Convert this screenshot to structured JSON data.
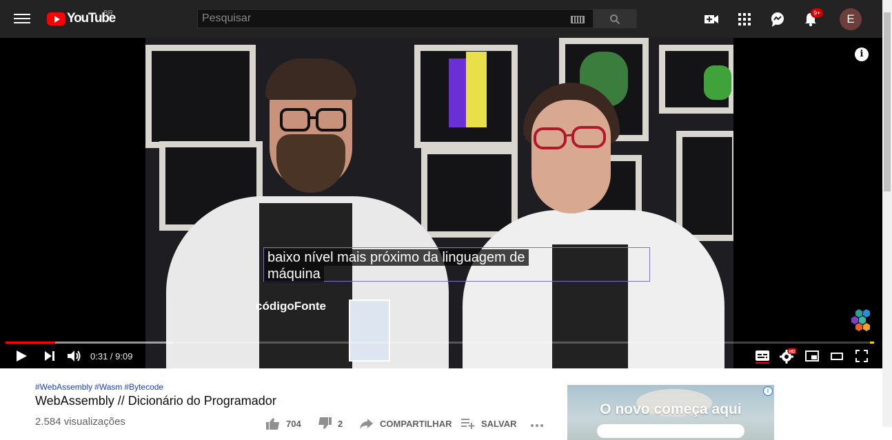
{
  "header": {
    "logo_text": "YouTube",
    "region": "BR",
    "search_placeholder": "Pesquisar",
    "notification_count": "9+",
    "avatar_letter": "E"
  },
  "player": {
    "caption_lines": [
      "baixo nível mais próximo da linguagem de",
      "máquina"
    ],
    "shirt_logo_text": "códigoFonte",
    "time_current": "0:31",
    "time_total": "9:09",
    "time_display": "0:31 / 9:09",
    "progress_played": 0.057,
    "progress_buffered": 0.193,
    "info_label": "i",
    "hd_badge": "HD"
  },
  "video": {
    "hashtags": [
      "#WebAssembly",
      "#Wasm",
      "#Bytecode"
    ],
    "title": "WebAssembly // Dicionário do Programador",
    "views": "2.584 visualizações",
    "likes": "704",
    "dislikes": "2",
    "share_label": "COMPARTILHAR",
    "save_label": "SALVAR"
  },
  "ad": {
    "text": "O novo começa aqui",
    "choice_label": "i"
  },
  "colors": {
    "masthead": "#232323",
    "accent": "#ff0000",
    "link": "#065fd4"
  }
}
